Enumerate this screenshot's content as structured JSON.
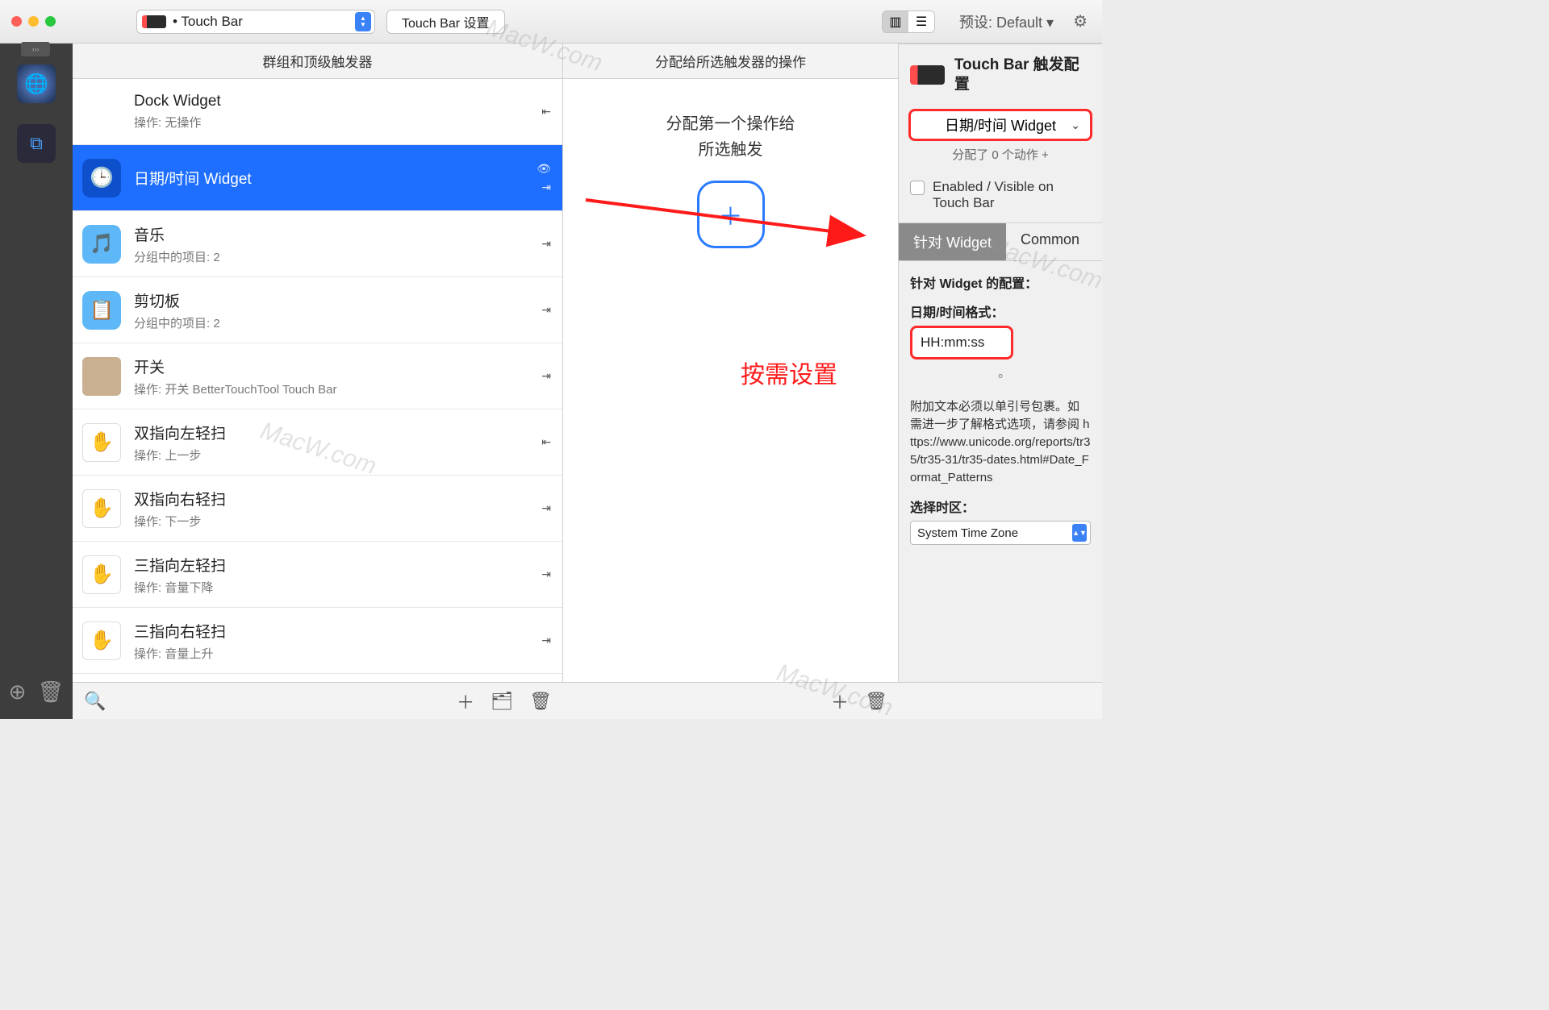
{
  "toolbar": {
    "selector_label": "• Touch Bar",
    "settings_btn": "Touch Bar 设置",
    "preset_label": "预设: Default ▾"
  },
  "columns": {
    "triggers_header": "群组和顶级触发器",
    "actions_header": "分配给所选触发器的操作"
  },
  "triggers": [
    {
      "title": "Dock Widget",
      "subtitle": "操作: 无操作",
      "icon": "none",
      "tail": "⇤"
    },
    {
      "title": "日期/时间 Widget",
      "subtitle": "",
      "icon": "clock",
      "selected": true,
      "tail_top": "👁",
      "tail_bot": "⇥"
    },
    {
      "title": "音乐",
      "subtitle": "分组中的项目: 2",
      "icon": "folder-music",
      "tail": "⇥"
    },
    {
      "title": "剪切板",
      "subtitle": "分组中的项目: 2",
      "icon": "folder-clip",
      "tail": "⇥"
    },
    {
      "title": "开关",
      "subtitle": "操作: 开关 BetterTouchTool Touch Bar",
      "icon": "avatar",
      "tail": "⇥"
    },
    {
      "title": "双指向左轻扫",
      "subtitle": "操作: 上一步",
      "icon": "hand",
      "tail": "⇤"
    },
    {
      "title": "双指向右轻扫",
      "subtitle": "操作: 下一步",
      "icon": "hand",
      "tail": "⇥"
    },
    {
      "title": "三指向左轻扫",
      "subtitle": "操作: 音量下降",
      "icon": "hand",
      "tail": "⇥"
    },
    {
      "title": "三指向右轻扫",
      "subtitle": "操作: 音量上升",
      "icon": "hand",
      "tail": "⇥"
    }
  ],
  "actions": {
    "message_line1": "分配第一个操作给",
    "message_line2": "所选触发"
  },
  "inspector": {
    "title": "Touch Bar 触发配置",
    "widget_type": "日期/时间 Widget",
    "assigned_note": "分配了 0 个动作 +",
    "enabled_label": "Enabled / Visible on Touch Bar",
    "tab_widget": "针对 Widget",
    "tab_common": "Common",
    "config_heading": "针对 Widget 的配置：",
    "format_label": "日期/时间格式：",
    "format_value": "HH:mm:ss",
    "help_text": "附加文本必须以单引号包裹。如需进一步了解格式选项，请参阅 https://www.unicode.org/reports/tr35/tr35-31/tr35-dates.html#Date_Format_Patterns",
    "tz_label": "选择时区：",
    "tz_value": "System Time Zone"
  },
  "annotation": {
    "red_text": "按需设置"
  },
  "watermark": "MacW.com"
}
